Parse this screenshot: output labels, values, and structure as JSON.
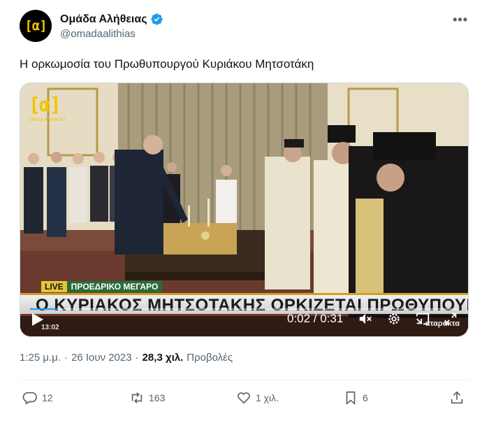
{
  "author": {
    "display_name": "Ομάδα Αλήθειας",
    "handle": "@omadaalithias",
    "avatar_text": "[α]",
    "verified": true
  },
  "more_icon": "more-horizontal-icon",
  "tweet": {
    "text": "Η ορκωμοσία του Πρωθυπουργού Κυριάκου Μητσοτάκη"
  },
  "video": {
    "logo_text": "[α]",
    "logo_sub": "ΟΜΑΔΑ ΑΛΗΘΕΙΑΣ",
    "live_label": "LIVE",
    "location_label": "ΠΡΟΕΔΡΙΚΟ ΜΕΓΑΡΟ",
    "headline": "Ο ΚΥΡΙΑΚΟΣ ΜΗΤΣΟΤΑΚΗΣ ΟΡΚΙΖΕΤΑΙ ΠΡΩΘΥΠΟΥΡΓΟΣ",
    "ticker_time": "13:02",
    "ticker_brand": "αταράκτα",
    "time_display": "0:02 / 0:31",
    "progress_fraction": 0.065,
    "controls": [
      "play-icon",
      "mute-icon",
      "settings-icon",
      "pip-icon",
      "fullscreen-icon"
    ]
  },
  "meta": {
    "time": "1:25 μ.μ.",
    "separator": "·",
    "date": "26 Ιουν 2023",
    "views_count": "28,3 χιλ.",
    "views_label": "Προβολές"
  },
  "actions": {
    "replies": "12",
    "retweets": "163",
    "likes": "1 χιλ.",
    "bookmarks": "6"
  },
  "colors": {
    "accent": "#1d9bf0",
    "text_secondary": "#536471",
    "logo_yellow": "#f3c300"
  }
}
